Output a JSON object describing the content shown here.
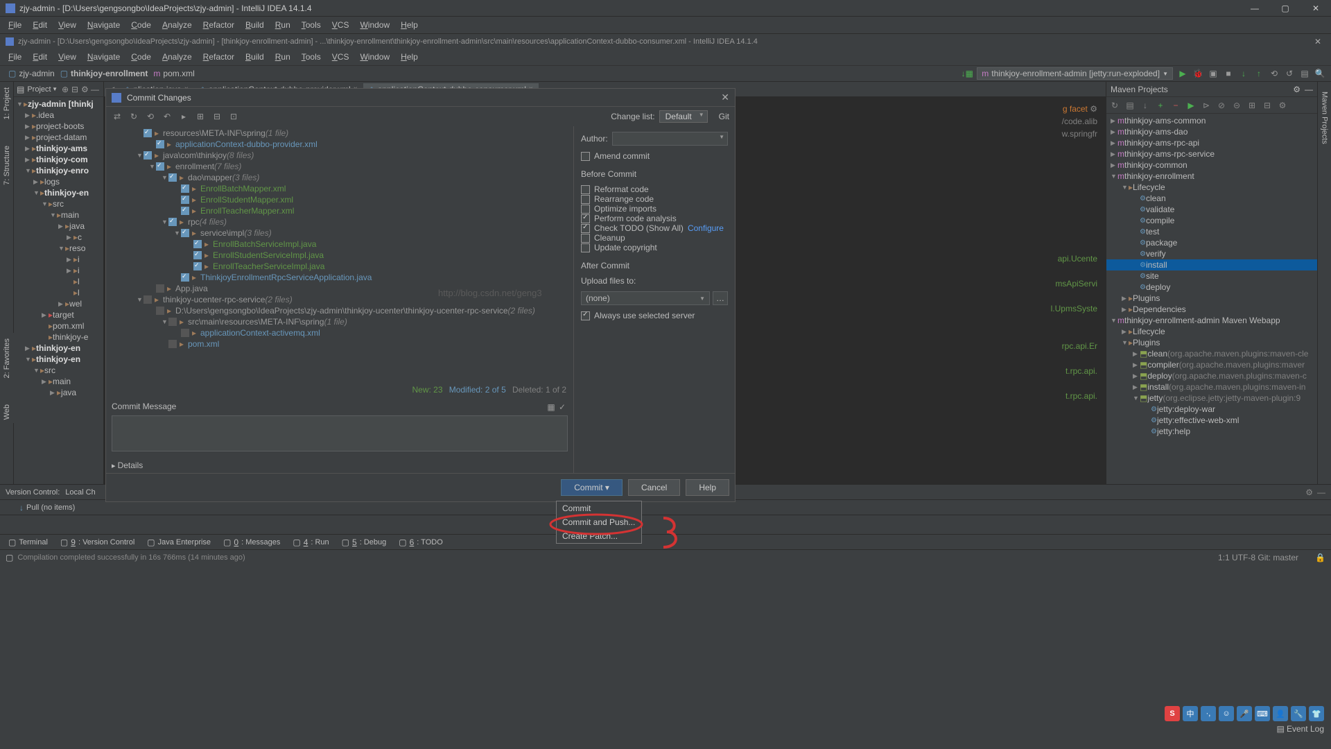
{
  "title_main": "zjy-admin - [D:\\Users\\gengsongbo\\IdeaProjects\\zjy-admin] - IntelliJ IDEA 14.1.4",
  "title_second": "zjy-admin - [D:\\Users\\gengsongbo\\IdeaProjects\\zjy-admin] - [thinkjoy-enrollment-admin] - ...\\thinkjoy-enrollment\\thinkjoy-enrollment-admin\\src\\main\\resources\\applicationContext-dubbo-consumer.xml - IntelliJ IDEA 14.1.4",
  "menu": [
    "File",
    "Edit",
    "View",
    "Navigate",
    "Code",
    "Analyze",
    "Refactor",
    "Build",
    "Run",
    "Tools",
    "VCS",
    "Window",
    "Help"
  ],
  "breadcrumb": {
    "project": "zjy-admin",
    "module": "thinkjoy-enrollment",
    "file": "pom.xml"
  },
  "run_config": "thinkjoy-enrollment-admin [jetty:run-exploded]",
  "left_tabs": [
    "1: Project",
    "7: Structure"
  ],
  "left_lower_tabs": [
    "2: Favorites",
    "Web"
  ],
  "right_tabs": [
    "Maven Projects"
  ],
  "project_panel_title": "Project",
  "project_tree": [
    {
      "d": 0,
      "a": "▼",
      "t": "zjy-admin [thinkj",
      "bold": true
    },
    {
      "d": 1,
      "a": "▶",
      "t": ".idea"
    },
    {
      "d": 1,
      "a": "▶",
      "t": "project-boots"
    },
    {
      "d": 1,
      "a": "▶",
      "t": "project-datam"
    },
    {
      "d": 1,
      "a": "▶",
      "t": "thinkjoy-ams",
      "bold": true
    },
    {
      "d": 1,
      "a": "▶",
      "t": "thinkjoy-com",
      "bold": true
    },
    {
      "d": 1,
      "a": "▼",
      "t": "thinkjoy-enro",
      "bold": true
    },
    {
      "d": 2,
      "a": "▶",
      "t": "logs"
    },
    {
      "d": 2,
      "a": "▼",
      "t": "thinkjoy-en",
      "bold": true
    },
    {
      "d": 3,
      "a": "▼",
      "t": "src"
    },
    {
      "d": 4,
      "a": "▼",
      "t": "main"
    },
    {
      "d": 5,
      "a": "▶",
      "t": "java"
    },
    {
      "d": 6,
      "a": "▶",
      "t": "c"
    },
    {
      "d": 5,
      "a": "▼",
      "t": "reso"
    },
    {
      "d": 6,
      "a": "▶",
      "t": "i"
    },
    {
      "d": 6,
      "a": "▶",
      "t": "i"
    },
    {
      "d": 6,
      "a": "",
      "t": "l"
    },
    {
      "d": 6,
      "a": "",
      "t": "l"
    },
    {
      "d": 5,
      "a": "▶",
      "t": "wel"
    },
    {
      "d": 3,
      "a": "▶",
      "t": "target",
      "red": true
    },
    {
      "d": 3,
      "a": "",
      "t": "pom.xml"
    },
    {
      "d": 3,
      "a": "",
      "t": "thinkjoy-e"
    },
    {
      "d": 1,
      "a": "▶",
      "t": "thinkjoy-en",
      "bold": true
    },
    {
      "d": 1,
      "a": "▼",
      "t": "thinkjoy-en",
      "bold": true
    },
    {
      "d": 2,
      "a": "▼",
      "t": "src"
    },
    {
      "d": 3,
      "a": "▶",
      "t": "main"
    },
    {
      "d": 4,
      "a": "▶",
      "t": "java"
    }
  ],
  "editor_tabs": [
    {
      "label": "plication.java"
    },
    {
      "label": "applicationContext-dubbo-provider.xml"
    },
    {
      "label": "applicationContext-dubbo-consumer.xml",
      "active": true
    }
  ],
  "visible_code_fragments": [
    "g facet",
    "/code.alib",
    "w.springfr",
    "api.Ucente",
    "msApiServi",
    "l.UpmsSyste",
    "rpc.api.Er",
    "t.rpc.api.",
    "t.rpc.api."
  ],
  "maven": {
    "title": "Maven Projects",
    "tree": [
      {
        "d": 0,
        "a": "▶",
        "ic": "m",
        "t": "thinkjoy-ams-common"
      },
      {
        "d": 0,
        "a": "▶",
        "ic": "m",
        "t": "thinkjoy-ams-dao"
      },
      {
        "d": 0,
        "a": "▶",
        "ic": "m",
        "t": "thinkjoy-ams-rpc-api"
      },
      {
        "d": 0,
        "a": "▶",
        "ic": "m",
        "t": "thinkjoy-ams-rpc-service"
      },
      {
        "d": 0,
        "a": "▶",
        "ic": "m",
        "t": "thinkjoy-common"
      },
      {
        "d": 0,
        "a": "▼",
        "ic": "m",
        "t": "thinkjoy-enrollment"
      },
      {
        "d": 1,
        "a": "▼",
        "ic": "f",
        "t": "Lifecycle"
      },
      {
        "d": 2,
        "ic": "g",
        "t": "clean"
      },
      {
        "d": 2,
        "ic": "g",
        "t": "validate"
      },
      {
        "d": 2,
        "ic": "g",
        "t": "compile"
      },
      {
        "d": 2,
        "ic": "g",
        "t": "test"
      },
      {
        "d": 2,
        "ic": "g",
        "t": "package"
      },
      {
        "d": 2,
        "ic": "g",
        "t": "verify"
      },
      {
        "d": 2,
        "ic": "g",
        "t": "install",
        "sel": true
      },
      {
        "d": 2,
        "ic": "g",
        "t": "site"
      },
      {
        "d": 2,
        "ic": "g",
        "t": "deploy"
      },
      {
        "d": 1,
        "a": "▶",
        "ic": "f",
        "t": "Plugins"
      },
      {
        "d": 1,
        "a": "▶",
        "ic": "f",
        "t": "Dependencies"
      },
      {
        "d": 0,
        "a": "▼",
        "ic": "m",
        "t": "thinkjoy-enrollment-admin Maven Webapp"
      },
      {
        "d": 1,
        "a": "▶",
        "ic": "f",
        "t": "Lifecycle"
      },
      {
        "d": 1,
        "a": "▼",
        "ic": "f",
        "t": "Plugins"
      },
      {
        "d": 2,
        "a": "▶",
        "ic": "p",
        "t": "clean",
        "gray": "(org.apache.maven.plugins:maven-cle"
      },
      {
        "d": 2,
        "a": "▶",
        "ic": "p",
        "t": "compiler",
        "gray": "(org.apache.maven.plugins:maver"
      },
      {
        "d": 2,
        "a": "▶",
        "ic": "p",
        "t": "deploy",
        "gray": "(org.apache.maven.plugins:maven-c"
      },
      {
        "d": 2,
        "a": "▶",
        "ic": "p",
        "t": "install",
        "gray": "(org.apache.maven.plugins:maven-in"
      },
      {
        "d": 2,
        "a": "▼",
        "ic": "p",
        "t": "jetty",
        "gray": "(org.eclipse.jetty:jetty-maven-plugin:9"
      },
      {
        "d": 3,
        "ic": "g",
        "t": "jetty:deploy-war"
      },
      {
        "d": 3,
        "ic": "g",
        "t": "jetty:effective-web-xml"
      },
      {
        "d": 3,
        "ic": "g",
        "t": "jetty:help"
      }
    ]
  },
  "dialog": {
    "title": "Commit Changes",
    "change_list_label": "Change list:",
    "change_list_value": "Default",
    "vcs": "Git",
    "author_label": "Author:",
    "amend": "Amend commit",
    "before_commit": "Before Commit",
    "checks": [
      {
        "on": false,
        "t": "Reformat code"
      },
      {
        "on": false,
        "t": "Rearrange code"
      },
      {
        "on": false,
        "t": "Optimize imports"
      },
      {
        "on": true,
        "t": "Perform code analysis"
      },
      {
        "on": true,
        "t": "Check TODO (Show All)",
        "link": "Configure"
      },
      {
        "on": false,
        "t": "Cleanup"
      },
      {
        "on": false,
        "t": "Update copyright"
      }
    ],
    "after_commit": "After Commit",
    "upload_label": "Upload files to:",
    "upload_value": "(none)",
    "always_server": "Always use selected server",
    "tree": [
      {
        "d": 0,
        "a": "",
        "cb": "on",
        "t": "resources\\META-INF\\spring",
        "gray": "(1 file)",
        "cls": "folder"
      },
      {
        "d": 1,
        "cb": "on",
        "t": "applicationContext-dubbo-provider.xml",
        "cls": "blue"
      },
      {
        "d": 0,
        "a": "▼",
        "cb": "on",
        "t": "java\\com\\thinkjoy",
        "gray": "(8 files)",
        "cls": "folder"
      },
      {
        "d": 1,
        "a": "▼",
        "cb": "on",
        "t": "enrollment",
        "gray": "(7 files)",
        "cls": "folder"
      },
      {
        "d": 2,
        "a": "▼",
        "cb": "on",
        "t": "dao\\mapper",
        "gray": "(3 files)",
        "cls": "folder"
      },
      {
        "d": 3,
        "cb": "on",
        "t": "EnrollBatchMapper.xml",
        "cls": "green"
      },
      {
        "d": 3,
        "cb": "on",
        "t": "EnrollStudentMapper.xml",
        "cls": "green"
      },
      {
        "d": 3,
        "cb": "on",
        "t": "EnrollTeacherMapper.xml",
        "cls": "green"
      },
      {
        "d": 2,
        "a": "▼",
        "cb": "on",
        "t": "rpc",
        "gray": "(4 files)",
        "cls": "folder"
      },
      {
        "d": 3,
        "a": "▼",
        "cb": "on",
        "t": "service\\impl",
        "gray": "(3 files)",
        "cls": "folder"
      },
      {
        "d": 4,
        "cb": "on",
        "t": "EnrollBatchServiceImpl.java",
        "cls": "green"
      },
      {
        "d": 4,
        "cb": "on",
        "t": "EnrollStudentServiceImpl.java",
        "cls": "green"
      },
      {
        "d": 4,
        "cb": "on",
        "t": "EnrollTeacherServiceImpl.java",
        "cls": "green"
      },
      {
        "d": 3,
        "cb": "on",
        "t": "ThinkjoyEnrollmentRpcServiceApplication.java",
        "cls": "blue"
      },
      {
        "d": 1,
        "cb": "off",
        "t": "App.java",
        "cls": "folder"
      },
      {
        "d": 0,
        "a": "▼",
        "cb": "off",
        "t": "thinkjoy-ucenter-rpc-service",
        "gray": "(2 files)",
        "cls": "folder"
      },
      {
        "d": 1,
        "cb": "off",
        "t": "D:\\Users\\gengsongbo\\IdeaProjects\\zjy-admin\\thinkjoy-ucenter\\thinkjoy-ucenter-rpc-service",
        "gray": "(2 files)",
        "cls": "folder"
      },
      {
        "d": 2,
        "a": "▼",
        "cb": "off",
        "t": "src\\main\\resources\\META-INF\\spring",
        "gray": "(1 file)",
        "cls": "folder"
      },
      {
        "d": 3,
        "cb": "off",
        "t": "applicationContext-activemq.xml",
        "cls": "blue"
      },
      {
        "d": 2,
        "cb": "off",
        "t": "pom.xml",
        "cls": "blue"
      }
    ],
    "stats": {
      "new": "New: 23",
      "mod": "Modified: 2 of 5",
      "del": "Deleted: 1 of 2"
    },
    "commit_msg_label": "Commit Message",
    "details_label": "Details",
    "buttons": {
      "commit": "Commit",
      "cancel": "Cancel",
      "help": "Help"
    },
    "dropdown": [
      "Commit",
      "Commit and Push...",
      "Create Patch..."
    ]
  },
  "version_control": {
    "title": "Version Control:",
    "tab": "Local Ch",
    "pull": "Pull (no items)"
  },
  "bottom_tabs": [
    {
      "t": "Terminal"
    },
    {
      "t": "9: Version Control",
      "u": "9"
    },
    {
      "t": "Java Enterprise"
    },
    {
      "t": "0: Messages",
      "u": "0"
    },
    {
      "t": "4: Run",
      "u": "4"
    },
    {
      "t": "5: Debug",
      "u": "5"
    },
    {
      "t": "6: TODO",
      "u": "6"
    }
  ],
  "status": {
    "msg": "Compilation completed successfully in 16s 766ms (14 minutes ago)",
    "event_log": "Event Log",
    "right": "1:1   UTF-8   Git: master"
  },
  "watermark": "http://blog.csdn.net/geng3"
}
